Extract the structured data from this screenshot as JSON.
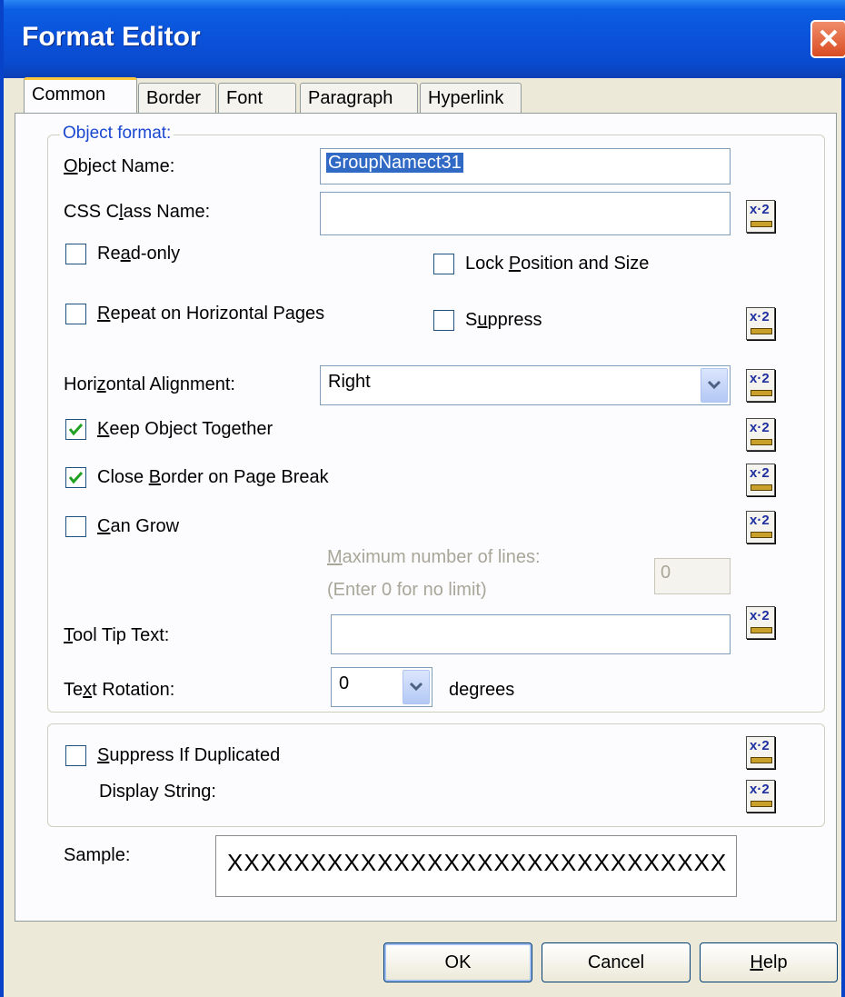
{
  "window": {
    "title": "Format Editor"
  },
  "tabs": [
    {
      "label": "Common",
      "active": true
    },
    {
      "label": "Border"
    },
    {
      "label": "Font"
    },
    {
      "label": "Paragraph"
    },
    {
      "label": "Hyperlink"
    }
  ],
  "object_format": {
    "legend": "Object format:",
    "object_name_label": "Object Name:",
    "object_name_value": "GroupNamect31",
    "css_class_label": "CSS Class Name:",
    "css_class_value": "",
    "read_only_label": "Read-only",
    "lock_position_label": "Lock Position and Size",
    "repeat_label": "Repeat on Horizontal Pages",
    "suppress_label": "Suppress",
    "horizontal_alignment_label": "Horizontal Alignment:",
    "horizontal_alignment_value": "Right",
    "keep_together_label": "Keep Object Together",
    "close_border_label": "Close Border on Page Break",
    "can_grow_label": "Can Grow",
    "max_lines_label": "Maximum number of lines:",
    "max_lines_hint": "(Enter 0 for no limit)",
    "max_lines_value": "0",
    "tooltip_label": "Tool Tip Text:",
    "tooltip_value": "",
    "text_rotation_label": "Text Rotation:",
    "text_rotation_value": "0",
    "degrees_label": "degrees"
  },
  "checks": {
    "read_only": false,
    "lock_position": false,
    "repeat": false,
    "suppress": false,
    "keep_together": true,
    "close_border": true,
    "can_grow": false,
    "suppress_duplicated": false
  },
  "duplicate": {
    "suppress_label": "Suppress If Duplicated",
    "display_string_label": "Display String:"
  },
  "sample": {
    "label": "Sample:",
    "text": "XXXXXXXXXXXXXXXXXXXXXXXXXXXXXX"
  },
  "buttons": {
    "ok": "OK",
    "cancel": "Cancel",
    "help": "Help"
  },
  "formula_button_glyph": "x-2",
  "icons": {
    "close": "close-icon",
    "formula": "formula-button-icon",
    "dropdown": "chevron-down-icon",
    "check": "checkmark-icon"
  }
}
